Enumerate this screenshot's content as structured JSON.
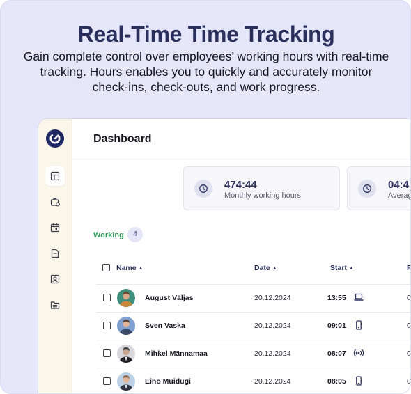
{
  "hero": {
    "title": "Real-Time Time Tracking",
    "subtitle": "Gain complete control over employees’ working hours with real-time tracking. Hours enables you to quickly and accurately monitor check-ins, check-outs, and work progress."
  },
  "colors": {
    "background": "#e5e6fa",
    "brand": "#1f2a63",
    "accent_green": "#2f9a5a",
    "sidebar": "#fbf6ea"
  },
  "sidebar": {
    "items": [
      {
        "icon": "dashboard-icon",
        "active": true
      },
      {
        "icon": "briefcase-clock-icon",
        "active": false
      },
      {
        "icon": "calendar-icon",
        "active": false
      },
      {
        "icon": "document-icon",
        "active": false
      },
      {
        "icon": "contact-card-icon",
        "active": false
      },
      {
        "icon": "folder-list-icon",
        "active": false
      }
    ]
  },
  "header": {
    "title": "Dashboard"
  },
  "stats": [
    {
      "value": "474:44",
      "label": "Monthly working hours",
      "icon": "clock-icon"
    },
    {
      "value": "04:4",
      "label": "Averag",
      "icon": "clock-icon"
    }
  ],
  "working": {
    "label": "Working",
    "count": "4"
  },
  "table": {
    "columns": {
      "name": "Name",
      "date": "Date",
      "start": "Start",
      "fourth": "P"
    },
    "rows": [
      {
        "name": "August Väljas",
        "date": "20.12.2024",
        "start": "13:55",
        "device": "laptop-icon",
        "cut": "0"
      },
      {
        "name": "Sven Vaska",
        "date": "20.12.2024",
        "start": "09:01",
        "device": "phone-icon",
        "cut": "0"
      },
      {
        "name": "Mihkel Männamaa",
        "date": "20.12.2024",
        "start": "08:07",
        "device": "rfid-icon",
        "cut": "0"
      },
      {
        "name": "Eino Muidugi",
        "date": "20.12.2024",
        "start": "08:05",
        "device": "phone-icon",
        "cut": "0"
      }
    ]
  }
}
